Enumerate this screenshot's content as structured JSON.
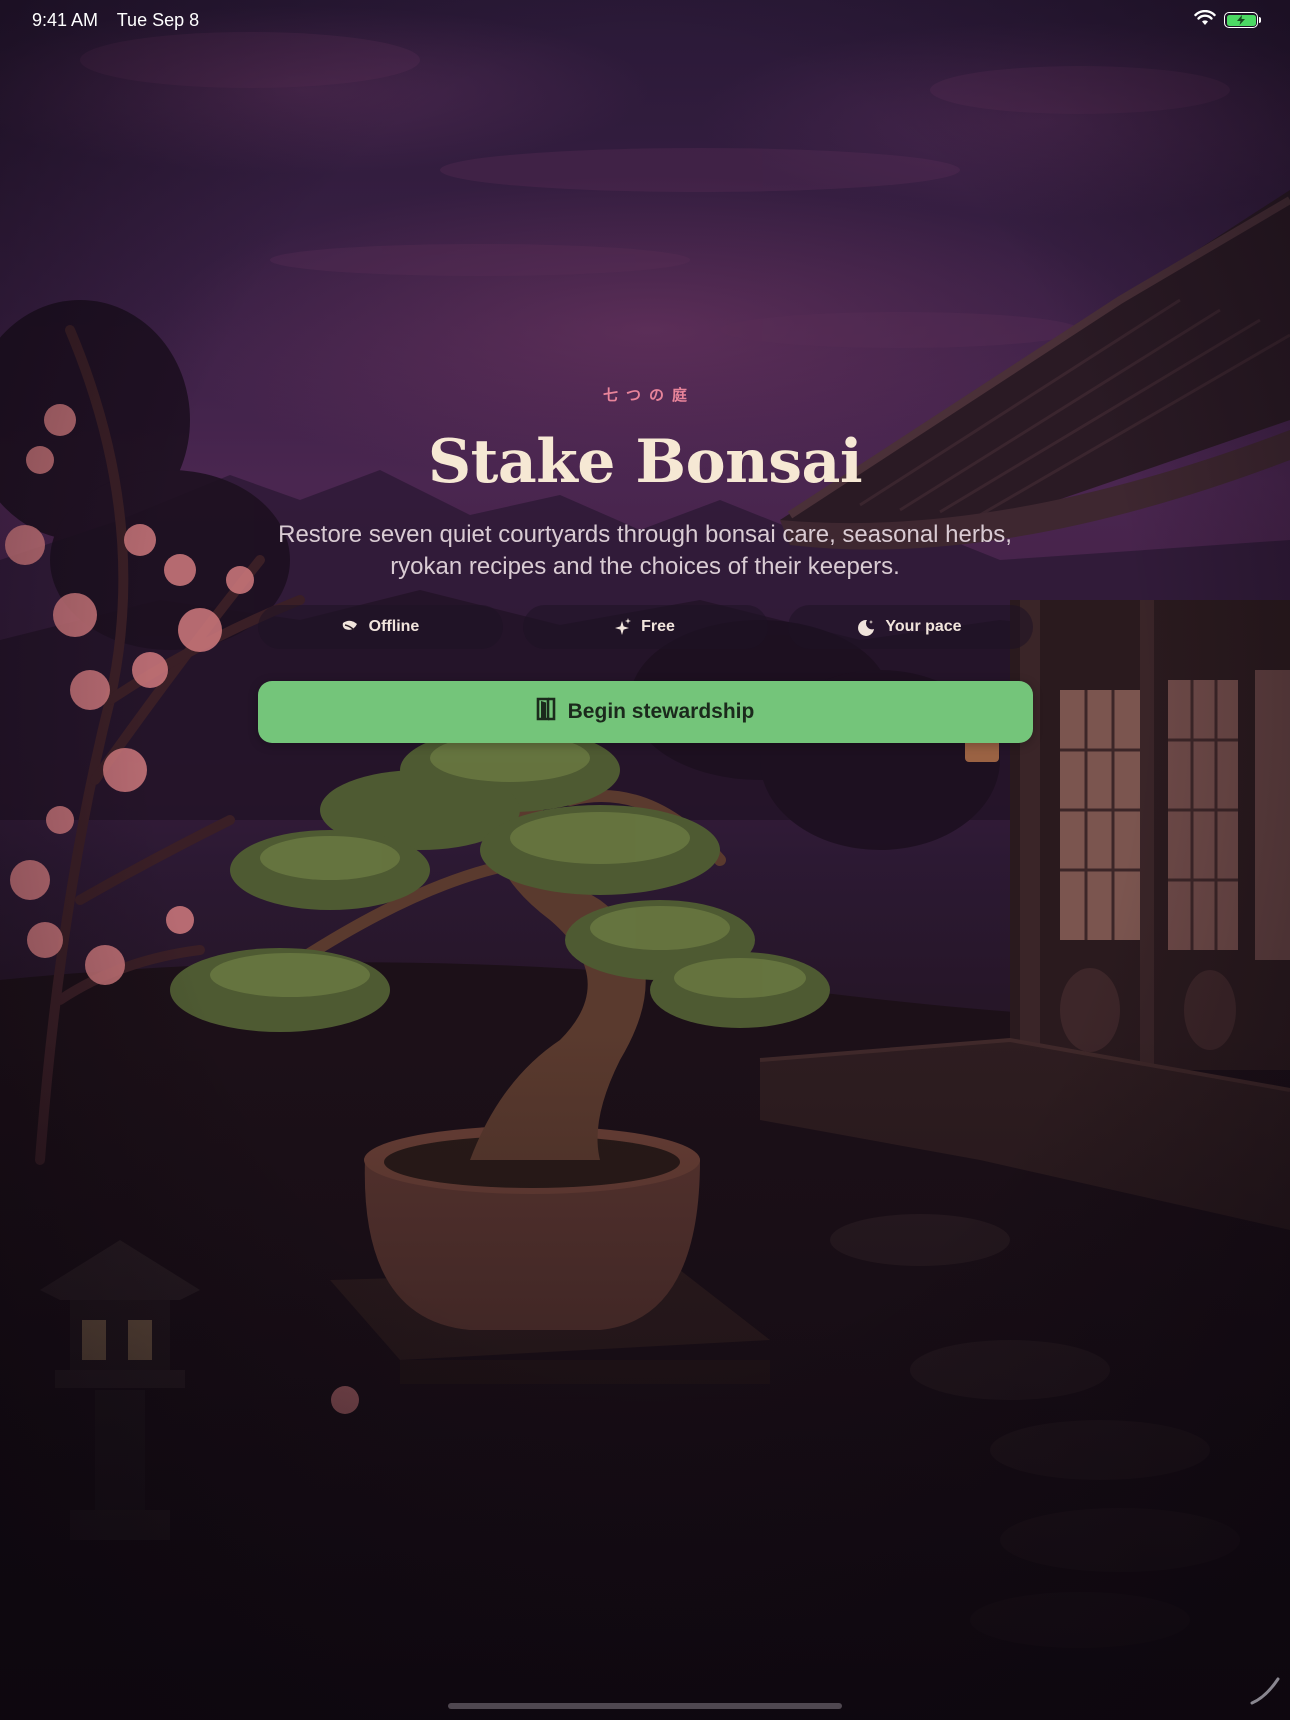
{
  "status_bar": {
    "time": "9:41 AM",
    "date": "Tue Sep 8",
    "icons": [
      "wifi-icon",
      "battery-charging-icon"
    ],
    "battery_color": "#4cd964"
  },
  "hero": {
    "kicker": "七つの庭",
    "title": "Stake Bonsai",
    "subtitle": "Restore seven quiet courtyards through bonsai care, seasonal herbs, ryokan recipes and the choices of their keepers.",
    "chips": [
      {
        "label": "Offline",
        "icon": "leaf-icon"
      },
      {
        "label": "Free",
        "icon": "sparkle-icon"
      },
      {
        "label": "Your pace",
        "icon": "moon-icon"
      }
    ],
    "cta": {
      "label": "Begin stewardship",
      "icon": "door-icon",
      "color": "#74c57a"
    }
  },
  "theme": {
    "title_color": "#f6e8d4",
    "kicker_color": "#e8849a",
    "background": "#1a0f1e"
  }
}
